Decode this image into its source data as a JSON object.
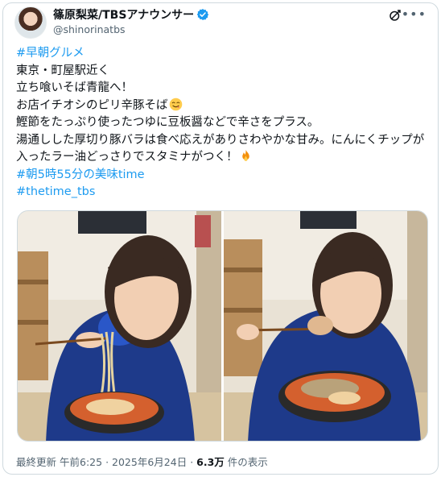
{
  "post": {
    "display_name": "篠原梨菜/TBSアナウンサー",
    "handle": "@shinorinatbs",
    "icons": {
      "avatar": "avatar",
      "verified": "verified-badge-icon",
      "grok": "grok-icon",
      "more": "more-icon"
    },
    "more_label": "•••",
    "lines": {
      "tag1": "#早朝グルメ",
      "l1": "東京・町屋駅近く",
      "l2": "立ち喰いそば青龍へ！",
      "l3": "お店イチオシのピリ辛豚そば",
      "l4": "鰹節をたっぷり使ったつゆに豆板醤などで辛さをプラス。",
      "l5": "湯通しした厚切り豚バラは食べ応えがありさわやかな甘み。にんにくチップが入ったラー油どっさりでスタミナがつく！",
      "tag2": "#朝5時55分の美味time",
      "tag3": "#thetime_tbs"
    },
    "emojis": {
      "yum": "face-savoring-food-emoji",
      "fire": "fire-emoji"
    }
  },
  "meta": {
    "prefix": "最終更新",
    "time": "午前6:25",
    "sep1": "·",
    "date": "2025年6月24日",
    "sep2": "·",
    "views_count": "6.3万",
    "views_suffix": " 件の表示"
  },
  "colors": {
    "link": "#1d9bf0",
    "verified": "#1d9bf0",
    "text": "#0f1419",
    "secondary": "#536471"
  }
}
